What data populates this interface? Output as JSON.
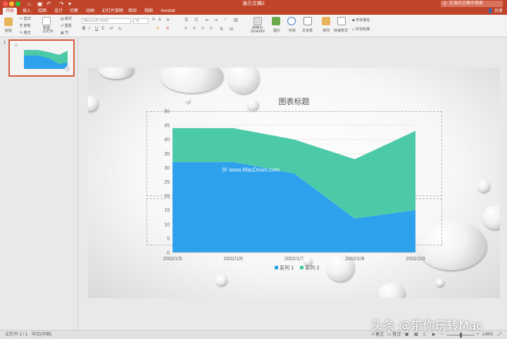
{
  "window": {
    "title": "演示文稿2",
    "search_placeholder": "在演示文稿中搜索"
  },
  "ribbon": {
    "tabs": [
      "开始",
      "插入",
      "绘图",
      "设计",
      "切换",
      "动画",
      "幻灯片放映",
      "审阅",
      "视图",
      "Acrobat"
    ],
    "active_tab": "开始",
    "share_label": "共享",
    "paste_label": "粘贴",
    "cut_label": "剪切",
    "copy_label": "复制",
    "format_label": "格式",
    "new_slide_label": "新建\n幻灯片",
    "layout_label": "版式",
    "reset_label": "重置",
    "section_label": "节",
    "font_name": "Microsoft YaHei",
    "font_size": "18",
    "convert_smartart_label": "转换为\nSmartArt",
    "picture_label": "图片",
    "shape_label": "形状",
    "textbox_label": "文本框",
    "arrange_label": "排列",
    "quick_styles_label": "快速样式",
    "shape_fill_label": "形状填充",
    "shape_outline_label": "形状轮廓"
  },
  "thumbnails": {
    "items": [
      {
        "number": "1"
      }
    ]
  },
  "slide": {
    "chart_title": "图表标题",
    "watermark_text": "www.MacDown.com"
  },
  "chart_data": {
    "type": "area",
    "title": "图表标题",
    "categories": [
      "2002/1/5",
      "2002/1/6",
      "2002/1/7",
      "2002/1/8",
      "2002/1/9"
    ],
    "series": [
      {
        "name": "系列 1",
        "values": [
          32,
          32,
          28,
          12,
          15
        ],
        "color": "#2ea1ec"
      },
      {
        "name": "系列 2",
        "values": [
          12,
          12,
          12,
          21,
          28
        ],
        "color": "#4ccaa8"
      }
    ],
    "stacked": true,
    "ylim": [
      0,
      50
    ],
    "yticks": [
      0,
      5,
      10,
      15,
      20,
      25,
      30,
      35,
      40,
      45,
      50
    ],
    "grid": true,
    "legend": "bottom"
  },
  "status_bar": {
    "slide_info": "幻灯片 1 / 1",
    "language": "中文(中国)",
    "notes_label": "备注",
    "comments_label": "批注",
    "zoom": "145%"
  },
  "overlay": {
    "watermark_caption": "头条 @带你玩转Mac"
  },
  "colors": {
    "accent": "#c0442a",
    "series1": "#2ea1ec",
    "series2": "#4ccaa8"
  }
}
